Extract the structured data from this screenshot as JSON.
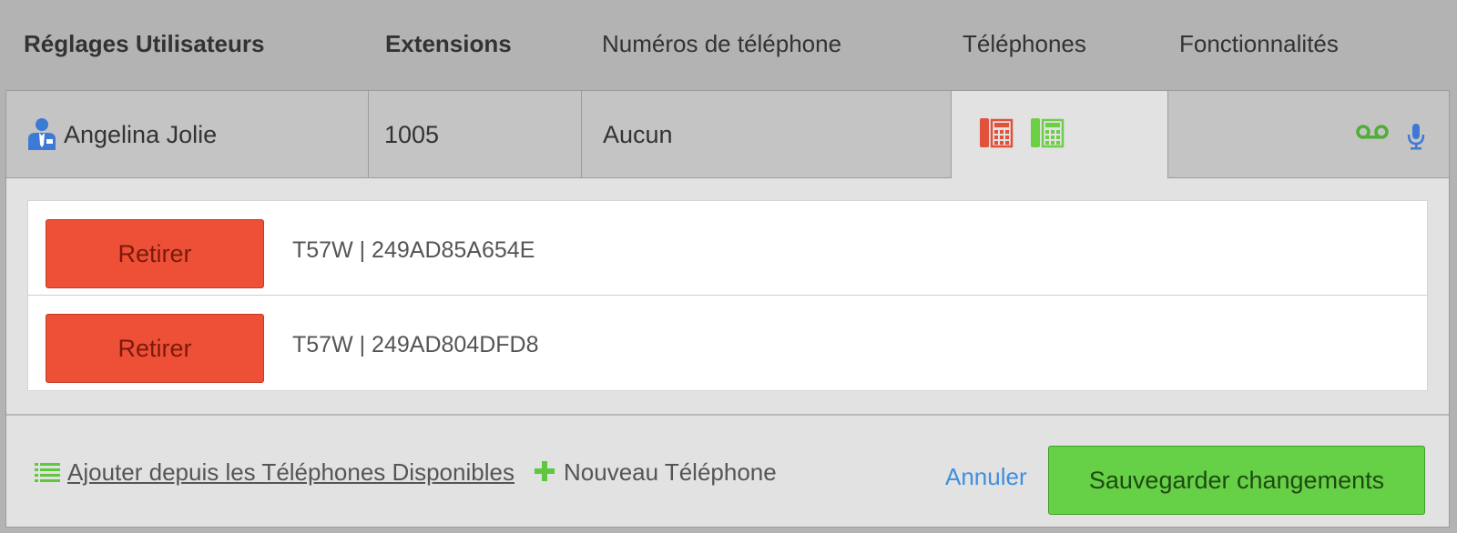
{
  "header": {
    "user_settings": "Réglages Utilisateurs",
    "extensions": "Extensions",
    "phone_numbers": "Numéros de téléphone",
    "phones": "Téléphones",
    "features": "Fonctionnalités"
  },
  "user_row": {
    "name": "Angelina Jolie",
    "extension": "1005",
    "phone_number": "Aucun"
  },
  "phones": [
    {
      "remove_label": "Retirer",
      "device": "T57W | 249AD85A654E"
    },
    {
      "remove_label": "Retirer",
      "device": "T57W | 249AD804DFD8"
    }
  ],
  "footer": {
    "add_available": "Ajouter depuis les Téléphones Disponibles",
    "new_phone": "Nouveau Téléphone",
    "cancel": "Annuler",
    "save": "Sauvegarder changements"
  },
  "colors": {
    "accent_red": "#ee5037",
    "accent_green": "#66d146",
    "link_blue": "#3f8fe0"
  }
}
